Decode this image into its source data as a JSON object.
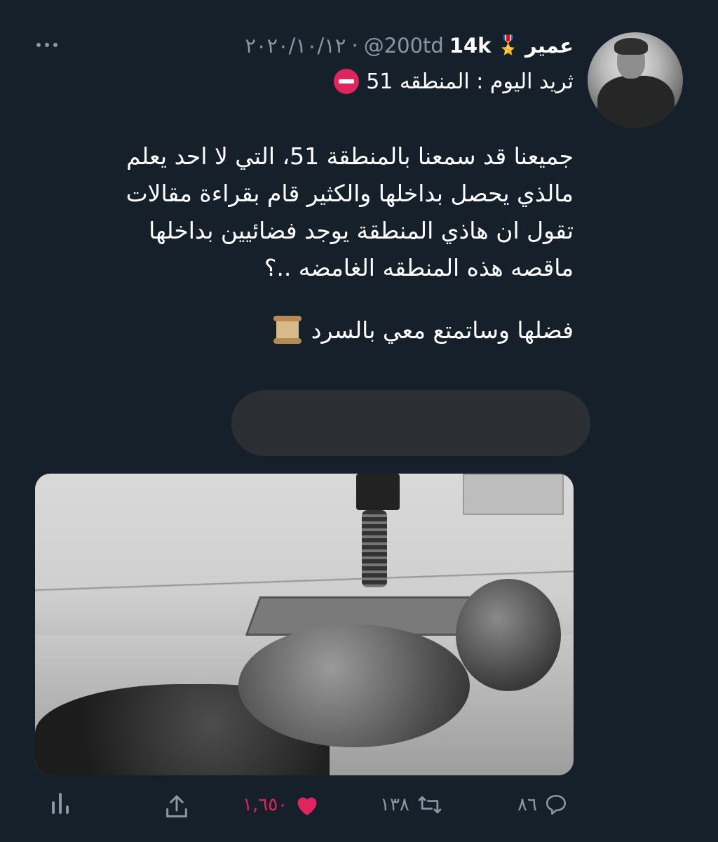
{
  "tweet": {
    "author_name": "عمير",
    "badge": "medal-icon",
    "follower_count": "14k",
    "handle": "@200td",
    "separator": "·",
    "date": "٢٠٢٠/١٠/١٢",
    "title": "ثريد اليوم : المنطقه 51",
    "title_icon": "no-entry-icon",
    "body_lines": [
      "جميعنا قد سمعنا بالمنطقة 51، التي لا احد يعلم",
      "مالذي يحصل بداخلها والكثير قام بقراءة مقالات",
      "تقول ان هاذي المنطقة يوجد فضائيين بداخلها",
      "ماقصه هذه المنطقه الغامضه ..؟"
    ],
    "cta": "فضلها وساتمتع معي بالسرد",
    "cta_icon": "scroll-icon"
  },
  "actions": {
    "replies": "٨٦",
    "retweets": "١٣٨",
    "likes": "١,٦٥٠",
    "like_color": "#e0245e"
  },
  "colors": {
    "background": "#15202b",
    "muted_text": "#8899a6",
    "text": "#ffffff"
  }
}
